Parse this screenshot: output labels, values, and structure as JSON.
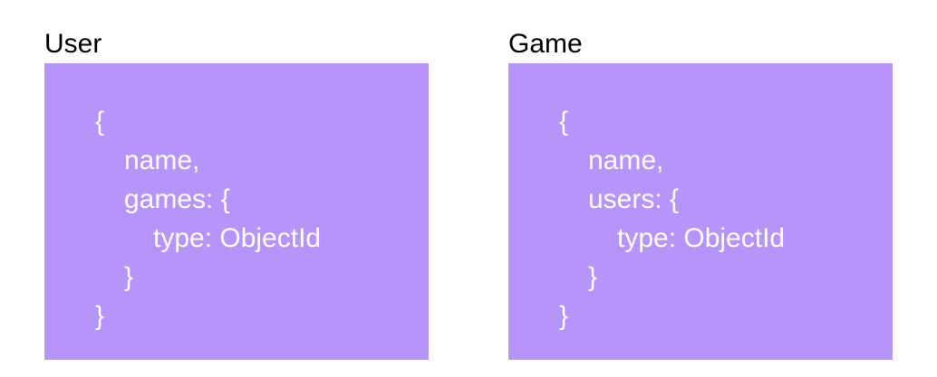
{
  "colors": {
    "box_background": "#b794fa",
    "code_text": "#ffffff",
    "title_text": "#000000"
  },
  "schemas": [
    {
      "title": "User",
      "lines": [
        "{",
        "name,",
        "games: {",
        "type: ObjectId",
        "}",
        "}"
      ]
    },
    {
      "title": "Game",
      "lines": [
        "{",
        "name,",
        "users: {",
        "type: ObjectId",
        "}",
        "}"
      ]
    }
  ]
}
